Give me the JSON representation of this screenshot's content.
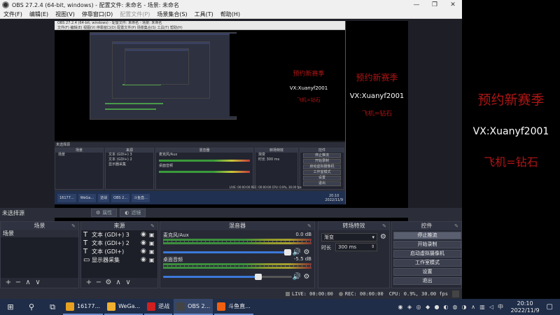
{
  "window": {
    "title": "OBS 27.2.4 (64-bit, windows) - 配置文件: 未命名 - 场景: 未命名",
    "controls": [
      "—",
      "❐",
      "✕"
    ]
  },
  "menu": {
    "items": [
      "文件(F)",
      "编辑(E)",
      "视图(V)",
      "停靠窗口(D)",
      "配置文件(P)",
      "场景集合(S)",
      "工具(T)",
      "帮助(H)"
    ],
    "disabled_index": 4
  },
  "nested": {
    "title": "OBS 27.2.4 (64-bit, windows) - 配置文件: 未命名 - 场景: 未命名",
    "menu": "文件(F)  编辑(E)  视图(V)  停靠窗口(D)  配置文件(P)  场景集合(S)  工具(T)  帮助(H)",
    "text1": "预约新赛季",
    "text2": "VX:Xuanyf2001",
    "text3": "飞机=钻石",
    "no_source": "未选择源",
    "scenes_header": "场景",
    "scene_item": "场景",
    "sources_header": "来源",
    "sources": [
      "文本 (GDI+) 3",
      "文本 (GDI+) 2",
      "显示器采集"
    ],
    "mixer_header": "混音器",
    "mixer_tracks": [
      "麦克风/Aux",
      "桌面音频"
    ],
    "trans_header": "转场特效",
    "trans_value": "渐变",
    "dur_label": "时长",
    "dur_value": "300 ms",
    "controls_header": "控件",
    "controls": [
      "停止推流",
      "开始录制",
      "启动虚拟摄像机",
      "工作室模式",
      "设置",
      "退出"
    ],
    "status": "LIVE: 00:00:00   REC: 00:00:00   CPU: 0.9%, 30.00 fps",
    "taskbar_items": [
      "16177...",
      "WeGa...",
      "逆战",
      "OBS 2...",
      "斗鱼直..."
    ],
    "clock_time": "20:10",
    "clock_date": "2022/11/9"
  },
  "overlay": {
    "line1": "预约新赛季",
    "line2": "VX:Xuanyf2001",
    "line3": "飞机=钻石"
  },
  "toolbar": {
    "no_source": "未选择源",
    "properties_label": "属性",
    "filters_label": "滤镜"
  },
  "scenes": {
    "header": "场景",
    "items": [
      "场景"
    ]
  },
  "sources": {
    "header": "来源",
    "items": [
      {
        "name": "文本 (GDI+) 3",
        "type": "T"
      },
      {
        "name": "文本 (GDI+) 2",
        "type": "T"
      },
      {
        "name": "文本 (GDI+)",
        "type": "T"
      },
      {
        "name": "显示器采集",
        "type": "monitor"
      }
    ]
  },
  "mixer": {
    "header": "混音器",
    "tracks": [
      {
        "name": "麦克风/Aux",
        "db": "0.0 dB",
        "volume": 0.97
      },
      {
        "name": "桌面音频",
        "db": "-5.5 dB",
        "volume": 0.74
      }
    ]
  },
  "transitions": {
    "header": "转场特效",
    "selected": "渐变",
    "duration_label": "时长",
    "duration_value": "300 ms"
  },
  "controls": {
    "header": "控件",
    "buttons": [
      "停止推流",
      "开始录制",
      "启动虚拟摄像机",
      "工作室模式",
      "设置",
      "退出"
    ]
  },
  "status": {
    "live": "LIVE: 00:00:00",
    "rec": "REC: 00:00:00",
    "cpu": "CPU: 0.9%, 30.00 fps"
  },
  "taskbar": {
    "apps": [
      {
        "label": "16177...",
        "color": "#e8a020"
      },
      {
        "label": "WeGa...",
        "color": "#f0b030"
      },
      {
        "label": "逆战",
        "color": "#d02020"
      },
      {
        "label": "OBS 2...",
        "color": "#444444"
      },
      {
        "label": "斗鱼直...",
        "color": "#f06010"
      }
    ],
    "clock_time": "20:10",
    "clock_date": "2022/11/9"
  },
  "colors": {
    "overlay_red": "#b01515",
    "obs_bg": "#2b2e38",
    "taskbar_bg": "#1f2d48"
  }
}
